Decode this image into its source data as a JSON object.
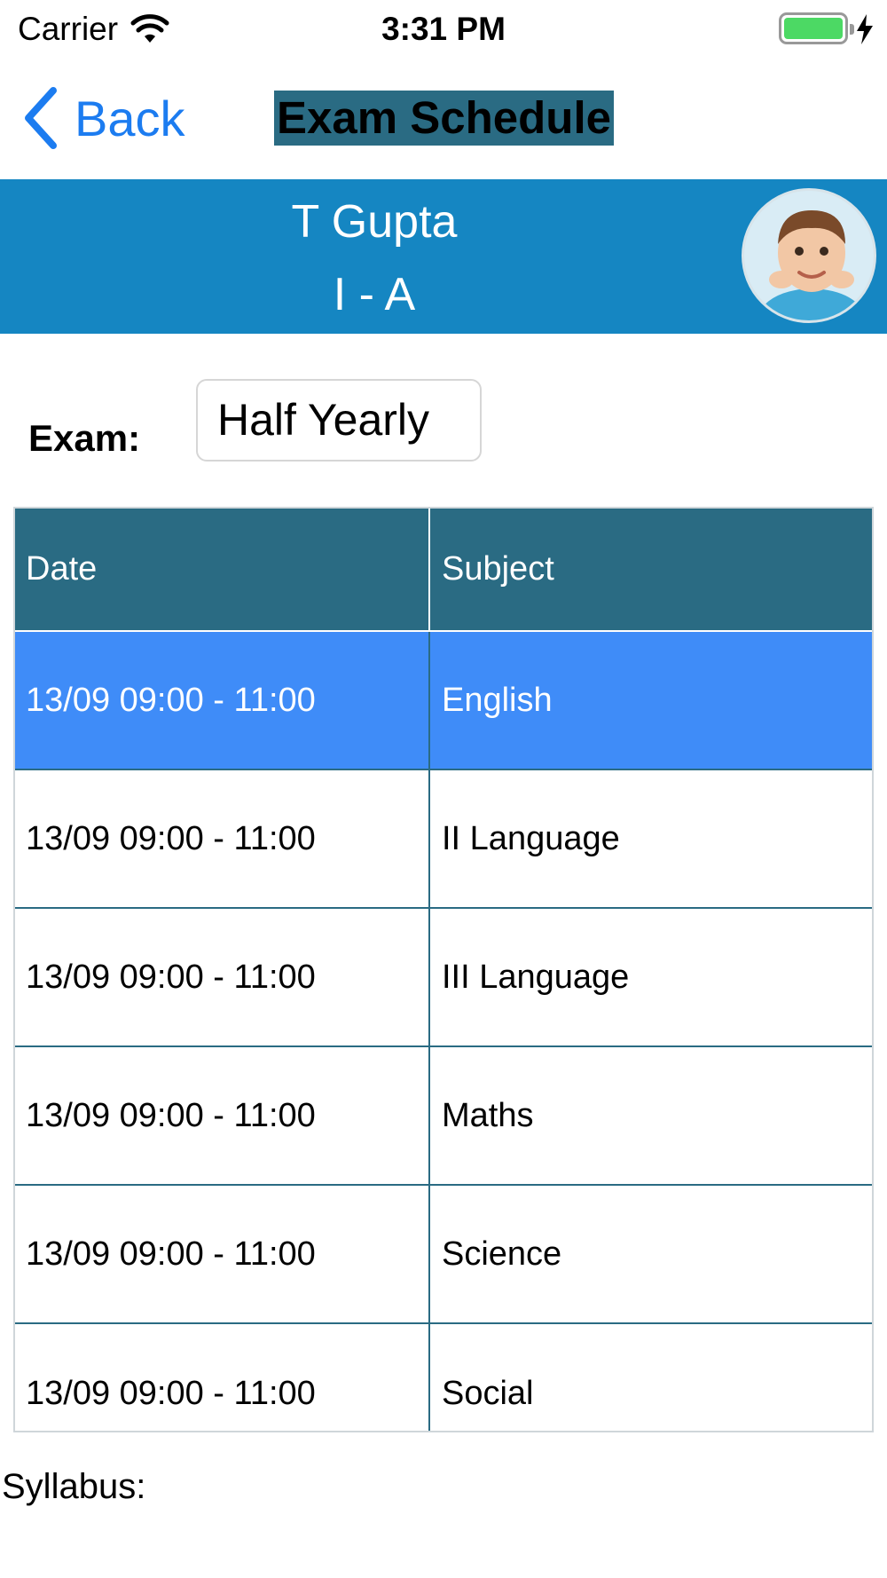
{
  "status_bar": {
    "carrier": "Carrier",
    "time": "3:31 PM",
    "battery_level": 1.0
  },
  "nav": {
    "back_label": "Back",
    "title": "Exam Schedule"
  },
  "student": {
    "name": "T Gupta",
    "class": "I - A"
  },
  "exam": {
    "label": "Exam:",
    "selected": "Half Yearly"
  },
  "table": {
    "headers": [
      "Date",
      "Subject"
    ],
    "rows": [
      {
        "date": "13/09 09:00 - 11:00",
        "subject": "English"
      },
      {
        "date": "13/09 09:00 - 11:00",
        "subject": "II Language"
      },
      {
        "date": "13/09 09:00 - 11:00",
        "subject": "III Language"
      },
      {
        "date": "13/09 09:00 - 11:00",
        "subject": "Maths"
      },
      {
        "date": "13/09 09:00 - 11:00",
        "subject": "Science"
      },
      {
        "date": "13/09 09:00 - 11:00",
        "subject": "Social"
      }
    ],
    "selected_index": 0
  },
  "syllabus_label": "Syllabus:",
  "colors": {
    "accent": "#1c7cf0",
    "banner": "#1586c2",
    "header": "#2a6b83",
    "selected_row": "#3f8cf8",
    "battery": "#4cd964"
  }
}
